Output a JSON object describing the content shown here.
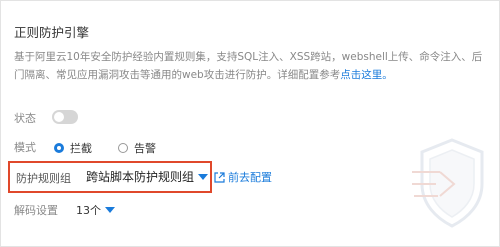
{
  "panel": {
    "title": "正则防护引擎",
    "description_main": "基于阿里云10年安全防护经验内置规则集，支持SQL注入、XSS跨站，webshell上传、命令注入、后门隔离、常见应用漏洞攻击等通用的web攻击进行防护。详细配置参考",
    "description_link": "点击这里。"
  },
  "status": {
    "label": "状态",
    "enabled": false
  },
  "mode": {
    "label": "模式",
    "options": [
      "拦截",
      "告警"
    ],
    "selected": "拦截"
  },
  "rule_group": {
    "label": "防护规则组",
    "value": "跨站脚本防护规则组",
    "goto_label": "前去配置"
  },
  "decode": {
    "label": "解码设置",
    "value": "13个"
  },
  "colors": {
    "accent": "#1a7bdb",
    "highlight": "#e0482b"
  },
  "icons": [
    "external-link-icon",
    "dropdown-caret-icon",
    "shield-decoration-icon"
  ]
}
